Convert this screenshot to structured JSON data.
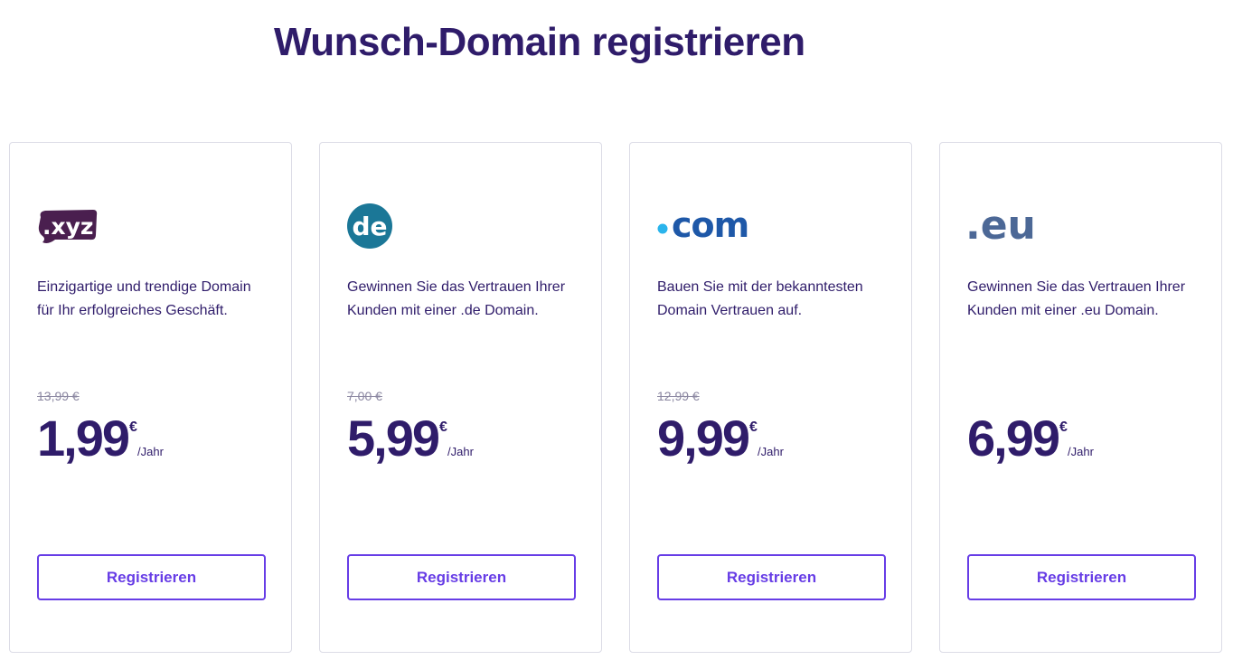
{
  "page": {
    "title": "Wunsch-Domain registrieren"
  },
  "cards": [
    {
      "tld": ".xyz",
      "logo_icon": "xyz-logo-icon",
      "description": "Einzigartige und trendige Domain für Ihr erfolgreiches Geschäft.",
      "old_price": "13,99 €",
      "price": "1,99",
      "currency": "€",
      "period": "/Jahr",
      "button_label": "Registrieren"
    },
    {
      "tld": "de",
      "logo_icon": "de-logo-icon",
      "description": "Gewinnen Sie das Vertrauen Ihrer Kunden mit einer .de Domain.",
      "old_price": "7,00 €",
      "price": "5,99",
      "currency": "€",
      "period": "/Jahr",
      "button_label": "Registrieren"
    },
    {
      "tld": "com",
      "logo_icon": "com-logo-icon",
      "description": "Bauen Sie mit der bekanntesten Domain Vertrauen auf.",
      "old_price": "12,99 €",
      "price": "9,99",
      "currency": "€",
      "period": "/Jahr",
      "button_label": "Registrieren"
    },
    {
      "tld": ".eu",
      "logo_icon": "eu-logo-icon",
      "description": "Gewinnen Sie das Vertrauen Ihrer Kunden mit einer .eu Domain.",
      "old_price": "",
      "price": "6,99",
      "currency": "€",
      "period": "/Jahr",
      "button_label": "Registrieren"
    }
  ],
  "colors": {
    "heading": "#2f1c6a",
    "accent": "#673de6",
    "xyz_logo": "#4a1f4f",
    "de_logo": "#1b7797",
    "com_logo": "#1e58a8",
    "com_dot": "#2ab4ec",
    "eu_logo": "#4c6896",
    "strike_text": "#8a86a0",
    "card_border": "#dcdce6"
  }
}
